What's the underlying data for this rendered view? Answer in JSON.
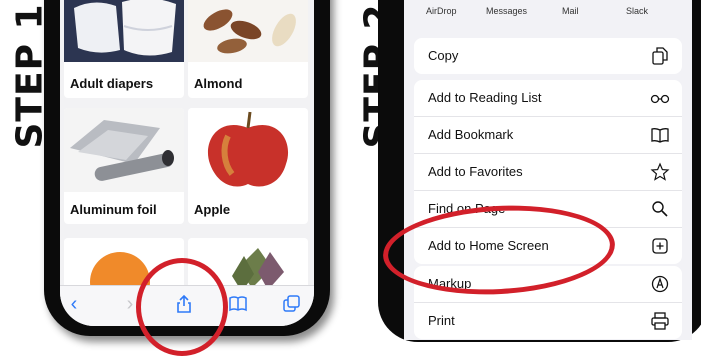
{
  "steps": {
    "step1": "STEP 1",
    "step2": "STEP 2"
  },
  "phone1": {
    "items": [
      {
        "label": "Adult diapers"
      },
      {
        "label": "Almond"
      },
      {
        "label": "Aluminum foil"
      },
      {
        "label": "Apple"
      },
      {
        "label": ""
      },
      {
        "label": ""
      }
    ],
    "toolbar": [
      "back-icon",
      "forward-icon",
      "share-icon",
      "bookmarks-icon",
      "tabs-icon"
    ],
    "colors": {
      "accent": "#2f7af8",
      "highlight": "#d2202a"
    }
  },
  "phone2": {
    "apps": [
      "AirDrop",
      "Messages",
      "Mail",
      "Slack"
    ],
    "copy": "Copy",
    "menu": [
      {
        "label": "Add to Reading List",
        "icon": "glasses-icon"
      },
      {
        "label": "Add Bookmark",
        "icon": "book-icon"
      },
      {
        "label": "Add to Favorites",
        "icon": "star-icon"
      },
      {
        "label": "Find on Page",
        "icon": "magnifier-icon"
      },
      {
        "label": "Add to Home Screen",
        "icon": "plus-square-icon"
      }
    ],
    "menu2": [
      {
        "label": "Markup",
        "icon": "markup-icon"
      },
      {
        "label": "Print",
        "icon": "printer-icon"
      }
    ]
  }
}
